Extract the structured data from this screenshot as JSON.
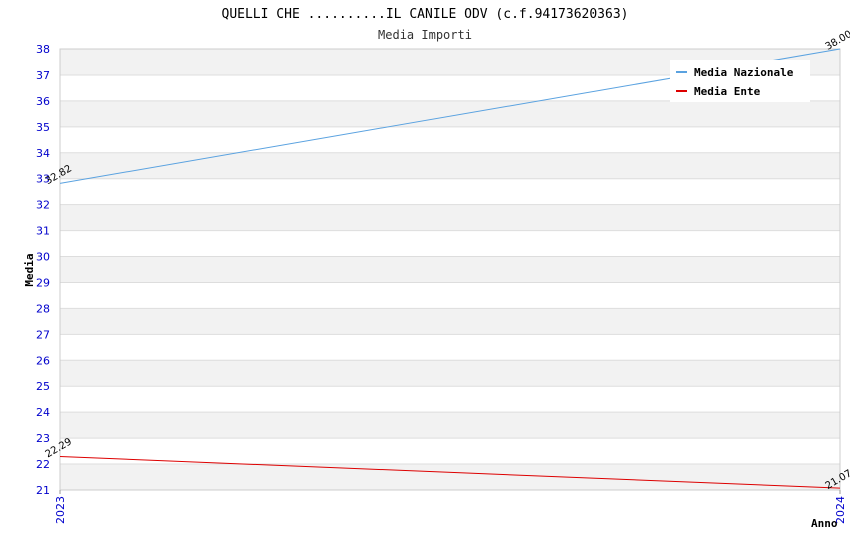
{
  "chart_data": {
    "type": "line",
    "title": "QUELLI CHE ..........IL CANILE ODV (c.f.94173620363)",
    "subtitle": "Media Importi",
    "xlabel": "Anno",
    "ylabel": "Media",
    "categories": [
      "2023",
      "2024"
    ],
    "ylim": [
      21,
      38
    ],
    "yticks": [
      "21",
      "22",
      "23",
      "24",
      "25",
      "26",
      "27",
      "28",
      "29",
      "30",
      "31",
      "32",
      "33",
      "34",
      "35",
      "36",
      "37",
      "38"
    ],
    "grid": true,
    "legend_position": "top-right",
    "series": [
      {
        "name": "Media Nazionale",
        "color": "#5aa2e0",
        "values": [
          32.82,
          38.0
        ],
        "labels": [
          "32.82",
          "38.00"
        ]
      },
      {
        "name": "Media Ente",
        "color": "#dd0000",
        "values": [
          22.29,
          21.07
        ],
        "labels": [
          "22.29",
          "21.07"
        ]
      }
    ]
  }
}
